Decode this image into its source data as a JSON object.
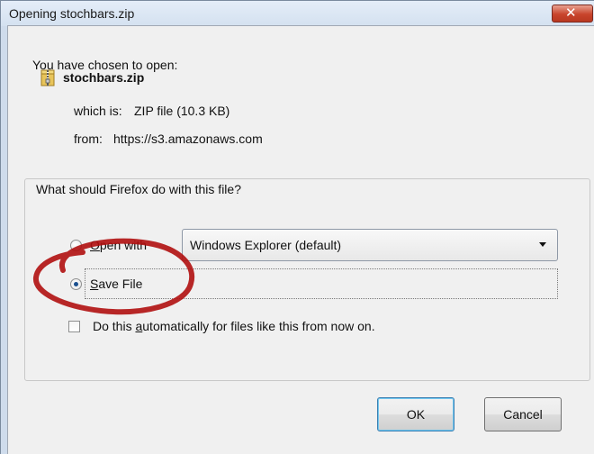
{
  "window": {
    "title": "Opening stochbars.zip",
    "close_icon": "close-icon"
  },
  "file": {
    "intro": "You have chosen to open:",
    "icon": "zip-file-icon",
    "name": "stochbars.zip",
    "which_is_label": "which is:",
    "which_is_value": "ZIP file (10.3 KB)",
    "from_label": "from:",
    "from_value": "https://s3.amazonaws.com"
  },
  "action_group": {
    "legend": "What should Firefox do with this file?",
    "open_with": {
      "label_underlined": "O",
      "label_rest": "pen with",
      "checked": false,
      "app_selected": "Windows Explorer (default)"
    },
    "save_file": {
      "label_underlined": "S",
      "label_rest": "ave File",
      "checked": true
    },
    "auto": {
      "label_before": "Do this ",
      "label_underlined": "a",
      "label_after": "utomatically for files like this from now on.",
      "checked": false
    }
  },
  "buttons": {
    "ok": "OK",
    "cancel": "Cancel"
  },
  "colors": {
    "annotation_ellipse": "#b01010",
    "close_button": "#c8442c"
  }
}
